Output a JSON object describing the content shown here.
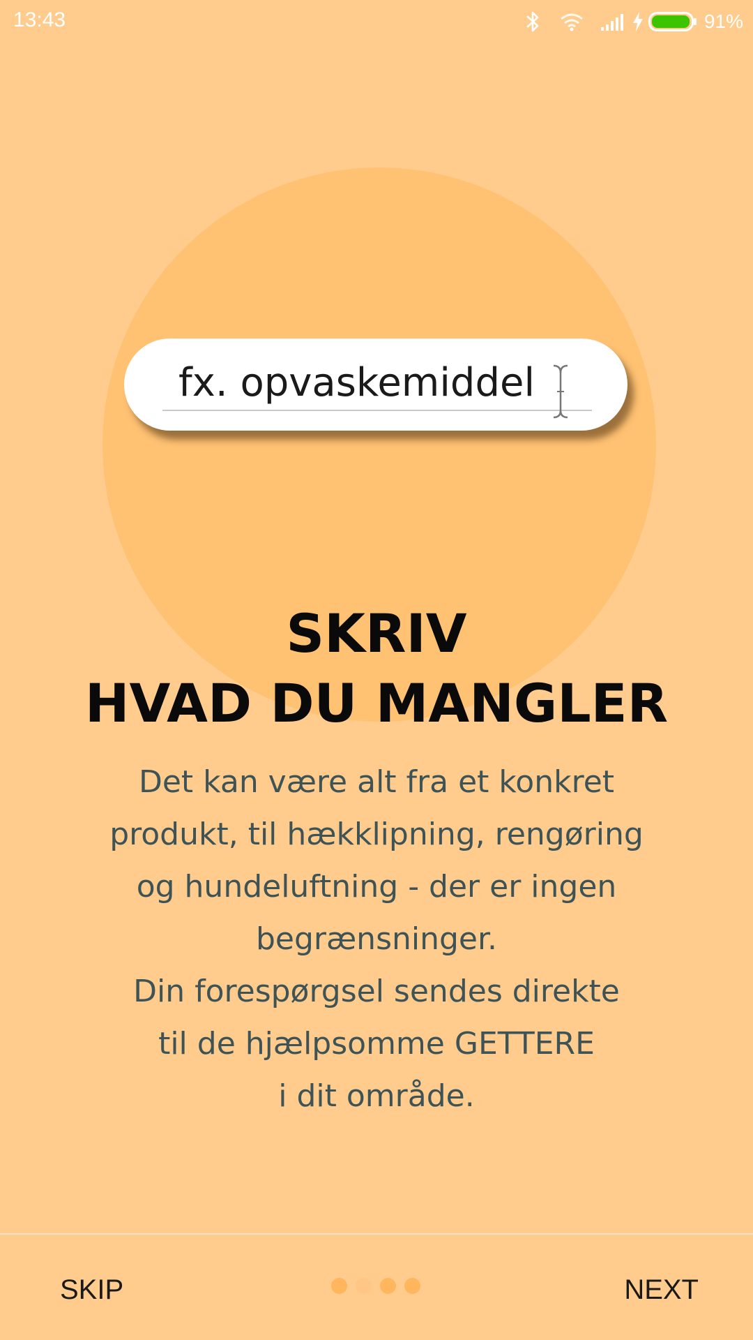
{
  "status_bar": {
    "time": "13:43",
    "battery_percent": "91%",
    "battery_level": 0.91,
    "icons": [
      "bluetooth-icon",
      "wifi-icon",
      "signal-icon",
      "charging-icon",
      "battery-icon"
    ],
    "battery_color": "#3DC400"
  },
  "illustration": {
    "search_text": "fx. opvaskemiddel",
    "circle_color": "#FFC273"
  },
  "headline": {
    "line1": "SKRIV",
    "line2": "HVAD DU MANGLER"
  },
  "body": {
    "lines": [
      "Det kan være alt fra et konkret",
      "produkt, til hækklipning, rengøring",
      "og hundeluftning - der er ingen",
      "begrænsninger.",
      "Din forespørgsel sendes direkte",
      "til de hjælpsomme GETTERE",
      "i dit område."
    ]
  },
  "footer": {
    "skip_label": "SKIP",
    "next_label": "NEXT",
    "page_count": 4,
    "current_page": 2,
    "dot_color": "#FFB65C",
    "dot_inactive_color": "#FFC685"
  },
  "colors": {
    "background": "#FFCC8E",
    "headline": "#0A0A0A",
    "body_text": "#3D5355"
  }
}
